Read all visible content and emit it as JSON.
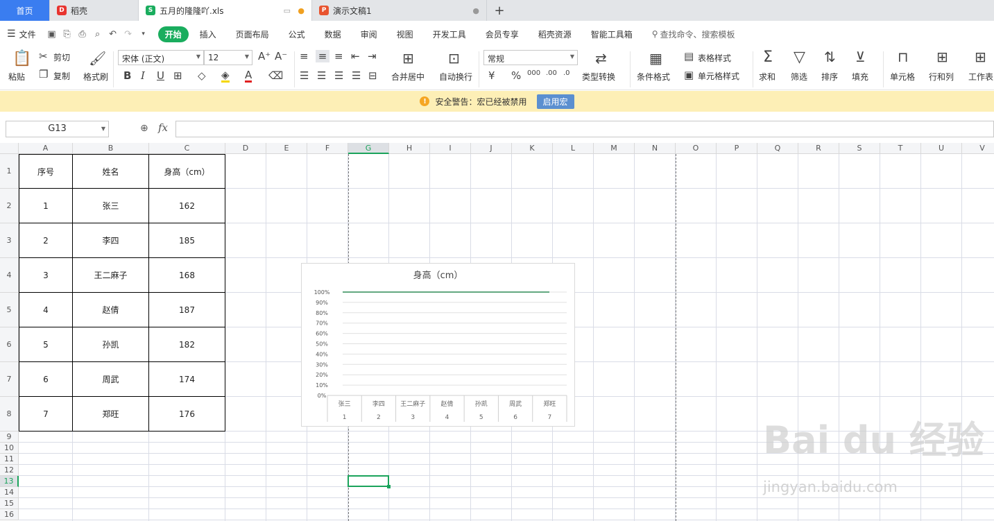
{
  "tabs": {
    "home": "首页",
    "daoke": "稻壳",
    "xls": "五月的隆隆吖.xls",
    "ppt": "演示文稿1",
    "new": "+"
  },
  "menu": {
    "file": "文件",
    "items": [
      "开始",
      "插入",
      "页面布局",
      "公式",
      "数据",
      "审阅",
      "视图",
      "开发工具",
      "会员专享",
      "稻壳资源",
      "智能工具箱"
    ],
    "search": "查找命令、搜索模板"
  },
  "ribbon": {
    "paste": "粘贴",
    "cut": "剪切",
    "copy": "复制",
    "format_painter": "格式刷",
    "font_name": "宋体 (正文)",
    "font_size": "12",
    "merge_center": "合并居中",
    "wrap_text": "自动换行",
    "number_format": "常规",
    "type_convert": "类型转换",
    "cond_format": "条件格式",
    "table_style": "表格样式",
    "cell_style": "单元格样式",
    "sum": "求和",
    "filter": "筛选",
    "sort": "排序",
    "fill": "填充",
    "cell": "单元格",
    "row_col": "行和列",
    "worksheet": "工作表"
  },
  "warning": {
    "text": "安全警告：宏已经被禁用",
    "button": "启用宏"
  },
  "formula": {
    "name_box": "G13",
    "fx": "fx"
  },
  "sheet": {
    "columns": [
      "A",
      "B",
      "C",
      "D",
      "E",
      "F",
      "G",
      "H",
      "I",
      "J",
      "K",
      "L",
      "M",
      "N",
      "O",
      "P",
      "Q",
      "R",
      "S",
      "T",
      "U",
      "V"
    ],
    "rows": [
      "1",
      "2",
      "3",
      "4",
      "5",
      "6",
      "7",
      "8",
      "9",
      "10",
      "11",
      "12",
      "13",
      "14",
      "15",
      "16"
    ],
    "header": [
      "序号",
      "姓名",
      "身高（cm）"
    ],
    "data": [
      [
        "1",
        "张三",
        "162"
      ],
      [
        "2",
        "李四",
        "185"
      ],
      [
        "3",
        "王二麻子",
        "168"
      ],
      [
        "4",
        "赵倩",
        "187"
      ],
      [
        "5",
        "孙凯",
        "182"
      ],
      [
        "6",
        "周武",
        "174"
      ],
      [
        "7",
        "郑旺",
        "176"
      ]
    ],
    "selected_cell": "G13"
  },
  "chart_data": {
    "type": "bar",
    "title": "身高（cm）",
    "categories": [
      "张三",
      "李四",
      "王二麻子",
      "赵倩",
      "孙凯",
      "周武",
      "郑旺"
    ],
    "category_numbers": [
      "1",
      "2",
      "3",
      "4",
      "5",
      "6",
      "7"
    ],
    "y_ticks": [
      "0%",
      "10%",
      "20%",
      "30%",
      "40%",
      "50%",
      "60%",
      "70%",
      "80%",
      "90%",
      "100%"
    ],
    "ylim": [
      0,
      100
    ],
    "grid": true,
    "line_color": "#2e8b57"
  },
  "watermark": {
    "logo": "Bai du 经验",
    "url": "jingyan.baidu.com"
  }
}
